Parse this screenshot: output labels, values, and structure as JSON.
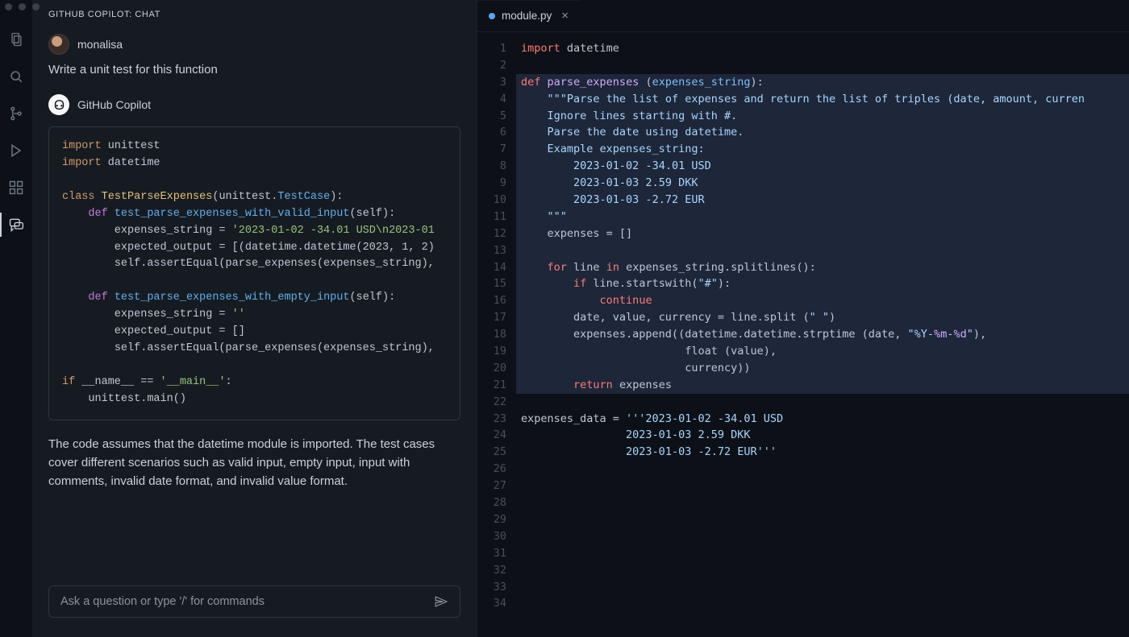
{
  "titlebar": {
    "dot_count": 3
  },
  "activitybar": {
    "items": [
      {
        "name": "files-icon"
      },
      {
        "name": "search-icon"
      },
      {
        "name": "source-control-icon"
      },
      {
        "name": "run-icon"
      },
      {
        "name": "extensions-icon"
      },
      {
        "name": "copilot-chat-icon",
        "active": true
      }
    ]
  },
  "sidebar": {
    "title": "GITHUB COPILOT: CHAT",
    "user": {
      "name": "monalisa",
      "prompt": "Write a unit test for this function"
    },
    "bot": {
      "name": "GitHub Copilot"
    },
    "code_lines": [
      [
        [
          "kw",
          "import"
        ],
        [
          "",
          " unittest"
        ]
      ],
      [
        [
          "kw",
          "import"
        ],
        [
          "",
          " datetime"
        ]
      ],
      [
        [
          "",
          ""
        ]
      ],
      [
        [
          "kw",
          "class"
        ],
        [
          "",
          " "
        ],
        [
          "cls",
          "TestParseExpenses"
        ],
        [
          "",
          "(unittest."
        ],
        [
          "def",
          "TestCase"
        ],
        [
          "",
          "):"
        ]
      ],
      [
        [
          "",
          "    "
        ],
        [
          "fn",
          "def"
        ],
        [
          "",
          " "
        ],
        [
          "def",
          "test_parse_expenses_with_valid_input"
        ],
        [
          "",
          "("
        ],
        [
          "self",
          "self"
        ],
        [
          "",
          "):"
        ]
      ],
      [
        [
          "",
          "        expenses_string = "
        ],
        [
          "str",
          "'2023-01-02 -34.01 USD\\n2023-01"
        ]
      ],
      [
        [
          "",
          "        expected_output = [(datetime.datetime("
        ],
        [
          "num",
          "2023"
        ],
        [
          "",
          ", "
        ],
        [
          "num",
          "1"
        ],
        [
          "",
          ", "
        ],
        [
          "num",
          "2"
        ],
        [
          "",
          ")"
        ]
      ],
      [
        [
          "",
          "        "
        ],
        [
          "self",
          "self"
        ],
        [
          "",
          ".assertEqual(parse_expenses(expenses_string),"
        ]
      ],
      [
        [
          "",
          ""
        ]
      ],
      [
        [
          "",
          "    "
        ],
        [
          "fn",
          "def"
        ],
        [
          "",
          " "
        ],
        [
          "def",
          "test_parse_expenses_with_empty_input"
        ],
        [
          "",
          "("
        ],
        [
          "self",
          "self"
        ],
        [
          "",
          "):"
        ]
      ],
      [
        [
          "",
          "        expenses_string = "
        ],
        [
          "str",
          "''"
        ]
      ],
      [
        [
          "",
          "        expected_output = []"
        ]
      ],
      [
        [
          "",
          "        "
        ],
        [
          "self",
          "self"
        ],
        [
          "",
          ".assertEqual(parse_expenses(expenses_string),"
        ]
      ],
      [
        [
          "",
          ""
        ]
      ],
      [
        [
          "kw",
          "if"
        ],
        [
          "",
          " __name__ == "
        ],
        [
          "str",
          "'__main__'"
        ],
        [
          "",
          ":"
        ]
      ],
      [
        [
          "",
          "    unittest.main()"
        ]
      ]
    ],
    "explanation": "The code assumes that the datetime module is imported. The test cases cover different scenarios such as valid input, empty input, input with comments, invalid date format, and invalid value format.",
    "input_placeholder": "Ask a question or type '/' for commands"
  },
  "editor": {
    "tab": {
      "filename": "module.py"
    },
    "line_count": 34,
    "selection": {
      "start": 3,
      "end": 21
    },
    "lines": [
      [
        [
          "py-kw",
          "import"
        ],
        [
          "",
          " datetime"
        ]
      ],
      [
        [
          "",
          ""
        ]
      ],
      [
        [
          "py-kw",
          "def"
        ],
        [
          "",
          " "
        ],
        [
          "py-fn",
          "parse_expenses"
        ],
        [
          "",
          " ("
        ],
        [
          "py-param",
          "expenses_string"
        ],
        [
          "",
          "):"
        ]
      ],
      [
        [
          "",
          "    "
        ],
        [
          "py-doc",
          "\"\"\"Parse the list of expenses and return the list of triples (date, amount, curren"
        ]
      ],
      [
        [
          "",
          "    "
        ],
        [
          "py-doc",
          "Ignore lines starting with #."
        ]
      ],
      [
        [
          "",
          "    "
        ],
        [
          "py-doc",
          "Parse the date using datetime."
        ]
      ],
      [
        [
          "",
          "    "
        ],
        [
          "py-doc",
          "Example expenses_string:"
        ]
      ],
      [
        [
          "",
          "        "
        ],
        [
          "py-doc",
          "2023-01-02 -34.01 USD"
        ]
      ],
      [
        [
          "",
          "        "
        ],
        [
          "py-doc",
          "2023-01-03 2.59 DKK"
        ]
      ],
      [
        [
          "",
          "        "
        ],
        [
          "py-doc",
          "2023-01-03 -2.72 EUR"
        ]
      ],
      [
        [
          "",
          "    "
        ],
        [
          "py-doc",
          "\"\"\""
        ]
      ],
      [
        [
          "",
          "    expenses = []"
        ]
      ],
      [
        [
          "",
          ""
        ]
      ],
      [
        [
          "",
          "    "
        ],
        [
          "py-kw",
          "for"
        ],
        [
          "",
          " line "
        ],
        [
          "py-kw",
          "in"
        ],
        [
          "",
          " expenses_string.splitlines():"
        ]
      ],
      [
        [
          "",
          "        "
        ],
        [
          "py-kw",
          "if"
        ],
        [
          "",
          " line.startswith("
        ],
        [
          "py-str",
          "\"#\""
        ],
        [
          "",
          "):"
        ]
      ],
      [
        [
          "",
          "            "
        ],
        [
          "py-kw2",
          "continue"
        ]
      ],
      [
        [
          "",
          "        date, value, currency = line.split ("
        ],
        [
          "py-str",
          "\" \""
        ],
        [
          "",
          ")"
        ]
      ],
      [
        [
          "",
          "        expenses.append((datetime.datetime.strptime (date, "
        ],
        [
          "py-str",
          "\"%Y-"
        ],
        [
          "py-fn",
          "%m"
        ],
        [
          "py-str",
          "-"
        ],
        [
          "py-fn",
          "%d"
        ],
        [
          "py-str",
          "\""
        ],
        [
          "",
          "),"
        ]
      ],
      [
        [
          "",
          "                         "
        ],
        [
          "py-built",
          "float"
        ],
        [
          "",
          " (value),"
        ]
      ],
      [
        [
          "",
          "                         currency))"
        ]
      ],
      [
        [
          "",
          "        "
        ],
        [
          "py-kw",
          "return"
        ],
        [
          "",
          " expenses"
        ]
      ],
      [
        [
          "",
          ""
        ]
      ],
      [
        [
          "",
          "expenses_data = "
        ],
        [
          "py-str",
          "'''2023-01-02 -34.01 USD"
        ]
      ],
      [
        [
          "",
          "                "
        ],
        [
          "py-str",
          "2023-01-03 2.59 DKK"
        ]
      ],
      [
        [
          "",
          "                "
        ],
        [
          "py-str",
          "2023-01-03 -2.72 EUR'''"
        ]
      ],
      [
        [
          "",
          ""
        ]
      ],
      [
        [
          "",
          ""
        ]
      ],
      [
        [
          "",
          ""
        ]
      ],
      [
        [
          "",
          ""
        ]
      ],
      [
        [
          "",
          ""
        ]
      ],
      [
        [
          "",
          ""
        ]
      ],
      [
        [
          "",
          ""
        ]
      ],
      [
        [
          "",
          ""
        ]
      ],
      [
        [
          "",
          ""
        ]
      ]
    ]
  }
}
